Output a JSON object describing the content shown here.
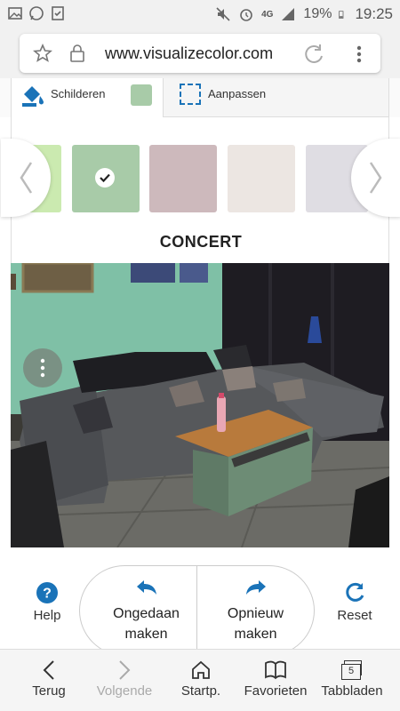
{
  "status_bar": {
    "battery": "19%",
    "time": "19:25",
    "network": "4G"
  },
  "browser": {
    "url": "www.visualizecolor.com"
  },
  "tabs": {
    "paint_label": "Schilderen",
    "adjust_label": "Aanpassen",
    "selected_color": "#a8cba8"
  },
  "carousel": {
    "color_name": "CONCERT",
    "swatches": [
      "#cbeab0",
      "#a8cba8",
      "#cdb9bc",
      "#ece6e2",
      "#dfdde3"
    ],
    "selected_index": 1
  },
  "actions": {
    "help": "Help",
    "undo_line1": "Ongedaan",
    "undo_line2": "maken",
    "redo_line1": "Opnieuw",
    "redo_line2": "maken",
    "reset": "Reset"
  },
  "nav": {
    "back": "Terug",
    "forward": "Volgende",
    "home": "Startp.",
    "favorites": "Favorieten",
    "tabs": "Tabbladen",
    "tab_count": "5"
  },
  "colors": {
    "accent": "#1a73b8",
    "wall": "#7fc0a6"
  }
}
